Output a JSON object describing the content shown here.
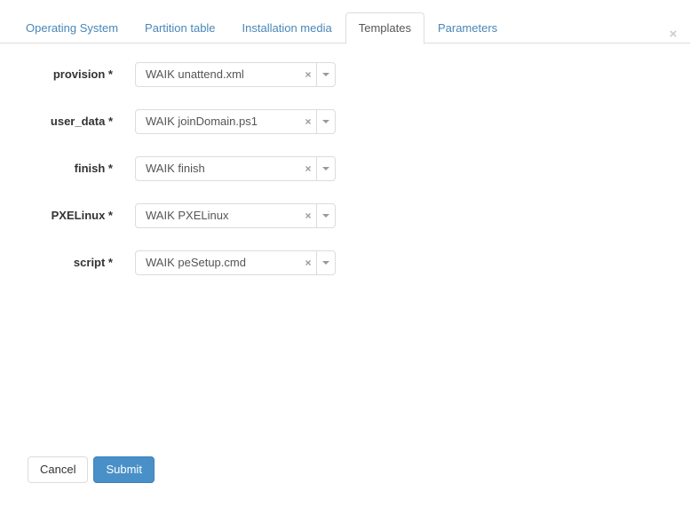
{
  "window": {
    "close_label": "×"
  },
  "colors": {
    "tab_link": "#4a87b8",
    "tab_active_text": "#555555",
    "primary_button": "#4a90c8",
    "border": "#dddddd",
    "label_text": "#333333"
  },
  "tabs": [
    {
      "label": "Operating System",
      "active": false
    },
    {
      "label": "Partition table",
      "active": false
    },
    {
      "label": "Installation media",
      "active": false
    },
    {
      "label": "Templates",
      "active": true
    },
    {
      "label": "Parameters",
      "active": false
    }
  ],
  "form": {
    "fields": [
      {
        "label": "provision *",
        "value": "WAIK unattend.xml",
        "clear_label": "×",
        "required": true
      },
      {
        "label": "user_data *",
        "value": "WAIK joinDomain.ps1",
        "clear_label": "×",
        "required": true
      },
      {
        "label": "finish *",
        "value": "WAIK finish",
        "clear_label": "×",
        "required": true
      },
      {
        "label": "PXELinux *",
        "value": "WAIK PXELinux",
        "clear_label": "×",
        "required": true
      },
      {
        "label": "script *",
        "value": "WAIK peSetup.cmd",
        "clear_label": "×",
        "required": true
      }
    ]
  },
  "footer": {
    "cancel_label": "Cancel",
    "submit_label": "Submit"
  }
}
